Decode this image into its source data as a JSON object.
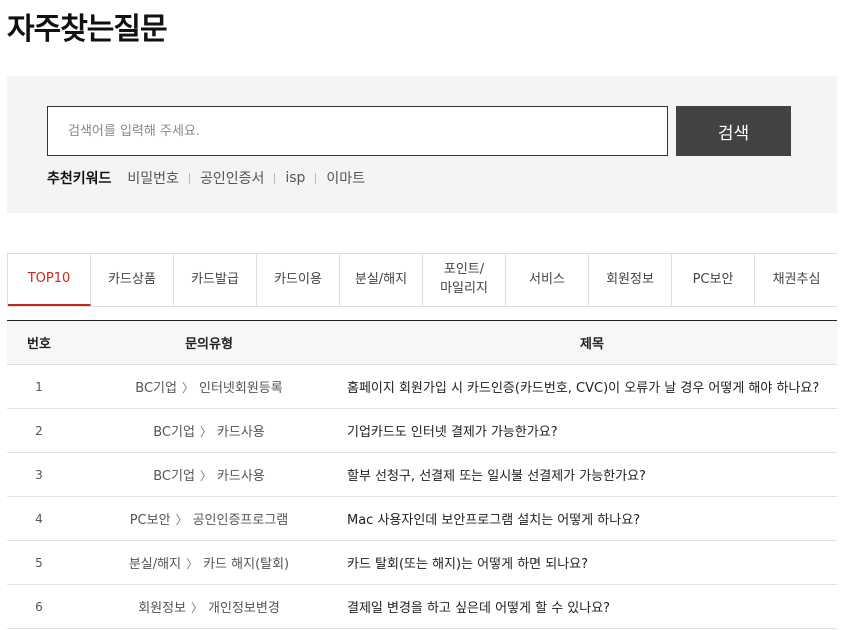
{
  "page": {
    "title": "자주찾는질문"
  },
  "search": {
    "placeholder": "검색어를 입력해 주세요.",
    "button_label": "검색",
    "keywords_label": "추천키워드",
    "keywords": [
      "비밀번호",
      "공인인증서",
      "isp",
      "이마트"
    ]
  },
  "tabs": [
    {
      "label": "TOP10",
      "active": true
    },
    {
      "label": "카드상품"
    },
    {
      "label": "카드발급"
    },
    {
      "label": "카드이용"
    },
    {
      "label": "분실/해지"
    },
    {
      "label": "포인트/\n마일리지"
    },
    {
      "label": "서비스"
    },
    {
      "label": "회원정보"
    },
    {
      "label": "PC보안"
    },
    {
      "label": "채권추심"
    }
  ],
  "table": {
    "headers": {
      "no": "번호",
      "type": "문의유형",
      "title": "제목"
    },
    "separator": "〉",
    "rows": [
      {
        "no": "1",
        "category": "BC기업",
        "subcategory": "인터넷회원등록",
        "title": "홈페이지 회원가입 시 카드인증(카드번호, CVC)이 오류가 날 경우 어떻게 해야 하나요?"
      },
      {
        "no": "2",
        "category": "BC기업",
        "subcategory": "카드사용",
        "title": "기업카드도 인터넷 결제가 가능한가요?"
      },
      {
        "no": "3",
        "category": "BC기업",
        "subcategory": "카드사용",
        "title": "할부 선청구, 선결제 또는 일시불 선결제가 가능한가요?"
      },
      {
        "no": "4",
        "category": "PC보안",
        "subcategory": "공인인증프로그램",
        "title": "Mac 사용자인데 보안프로그램 설치는 어떻게 하나요?"
      },
      {
        "no": "5",
        "category": "분실/해지",
        "subcategory": "카드 해지(탈회)",
        "title": "카드 탈회(또는 해지)는 어떻게 하면 되나요?"
      },
      {
        "no": "6",
        "category": "회원정보",
        "subcategory": "개인정보변경",
        "title": "결제일 변경을 하고 싶은데 어떻게 할 수 있나요?"
      }
    ]
  },
  "colors": {
    "accent": "#c8261f",
    "button_bg": "#424242",
    "panel_bg": "#f4f4f4"
  }
}
